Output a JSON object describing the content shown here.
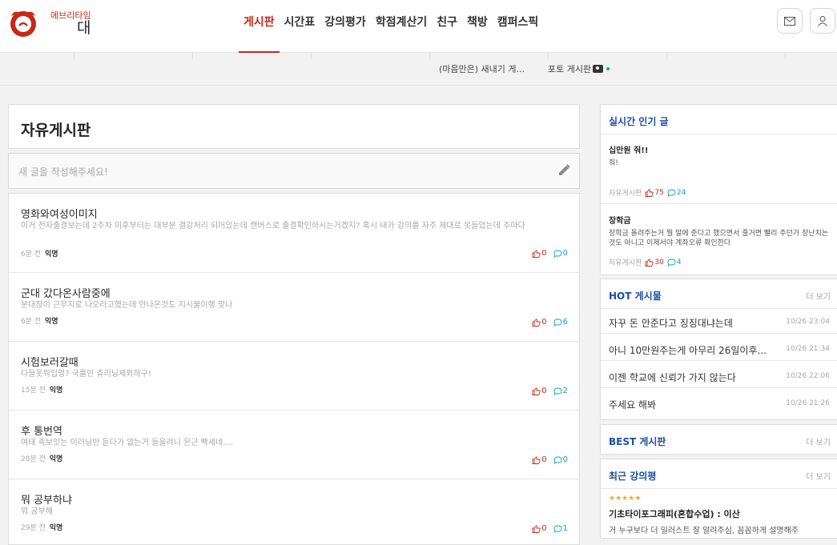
{
  "brand": {
    "small": "에브리타임",
    "big": "대"
  },
  "nav": [
    "게시판",
    "시간표",
    "강의평가",
    "학점계산기",
    "친구",
    "책방",
    "캠퍼스픽"
  ],
  "subbar": {
    "item1": "(마음만은) 새내기 게...",
    "item2": "포토 게시판"
  },
  "board": {
    "title": "자유게시판",
    "write_placeholder": "새 글을 작성해주세요!"
  },
  "posts": [
    {
      "title": "영화와여성이미지",
      "body": "이거 전자출결보는데 2주차 이후부터는 대부분 결강처리 되어있는데 캔버스로 출결확인하시는거겠지? 혹시 내가 강의를 자주 제대로 못들었는데 주마다",
      "time": "6분 전",
      "author": "익명",
      "votes": "0",
      "comments": "0"
    },
    {
      "title": "군대 갔다온사람중에",
      "body": "분대장이 근무지로 나오라고했는데 안나온것도 지시불이행 맞나",
      "time": "6분 전",
      "author": "익명",
      "votes": "0",
      "comments": "6"
    },
    {
      "title": "시험보러갈때",
      "body": "다들옷뭐입엉? 국룰인 츄리닝제외하구!",
      "time": "15분 전",
      "author": "익명",
      "votes": "0",
      "comments": "2"
    },
    {
      "title": "후 통번역",
      "body": "여태 족보잇는 이러닝만 듣다가 없는거 들을려니 은근 빡세네....",
      "time": "28분 전",
      "author": "익명",
      "votes": "0",
      "comments": "0"
    },
    {
      "title": "뭐 공부하냐",
      "body": "뭐 공부해",
      "time": "29분 전",
      "author": "익명",
      "votes": "0",
      "comments": "1"
    }
  ],
  "popular": {
    "title": "실시간 인기 글",
    "items": [
      {
        "title": "십만원 줘!!",
        "body": "줘!",
        "board": "자유게시판",
        "votes": "75",
        "comments": "24"
      },
      {
        "title": "장학금",
        "body": "장학금 돌려주는거 뭘 말에 준다고 했으면서 줄거면 빨리 주던가 장난치는것도 아니고 이제서야 계좌오류 확인한다",
        "board": "자유게시판",
        "votes": "30",
        "comments": "4"
      }
    ]
  },
  "hot": {
    "title": "HOT 게시물",
    "more": "더 보기",
    "items": [
      {
        "title": "자꾸 돈 안준다고 징징대냐는데",
        "time": "10/26 23:04"
      },
      {
        "title": "아니 10만원주는게 아무리 26일이후...",
        "time": "10/26 21:34"
      },
      {
        "title": "이젠 학교에 신뢰가 가지 않는다",
        "time": "10/26 22:06"
      },
      {
        "title": "주세요 해봐",
        "time": "10/26 21:26"
      }
    ]
  },
  "best": {
    "title": "BEST 게시판",
    "more": "더 보기"
  },
  "reviews": {
    "title": "최근 강의평",
    "more": "더 보기",
    "rating": 5,
    "course": "기초타이포그래피(혼합수업) : 이산",
    "body": "거 누구보다 더 일러스트 잘 알려주심, 꼼꼼하게 설명해주"
  },
  "colors": {
    "accent": "#c62917",
    "link_blue": "#1a4ea3",
    "comment_teal": "#0ca5af"
  }
}
